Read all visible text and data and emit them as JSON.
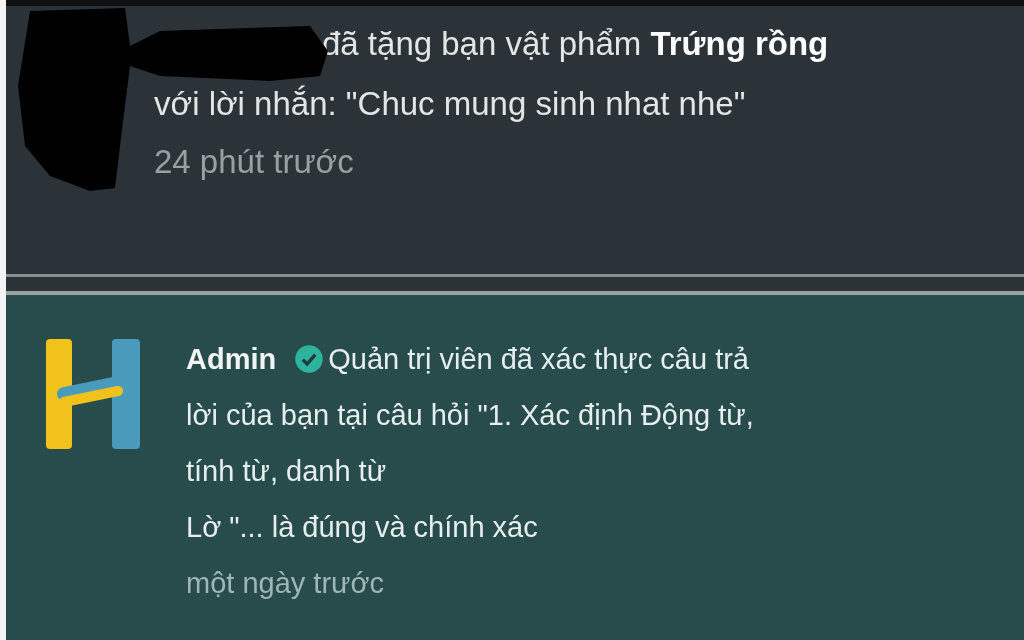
{
  "notifications": [
    {
      "kind": "gift",
      "redacted": true,
      "message": "đã tặng bạn vật phẩm **Trứng rồng**\nvới lời nhắn: \"Chuc mung sinh nhat nhe\"",
      "time": "24 phút trước"
    },
    {
      "kind": "admin",
      "author": "Admin",
      "verified": true,
      "message_first_line": "Quản trị viên đã xác thực câu trả",
      "message_rest": "lời của bạn tại câu hỏi \"1. Xác định Động từ,\ntính từ, danh từ\nLờ \"... là đúng và chính xác",
      "time": "một ngày trước"
    }
  ]
}
